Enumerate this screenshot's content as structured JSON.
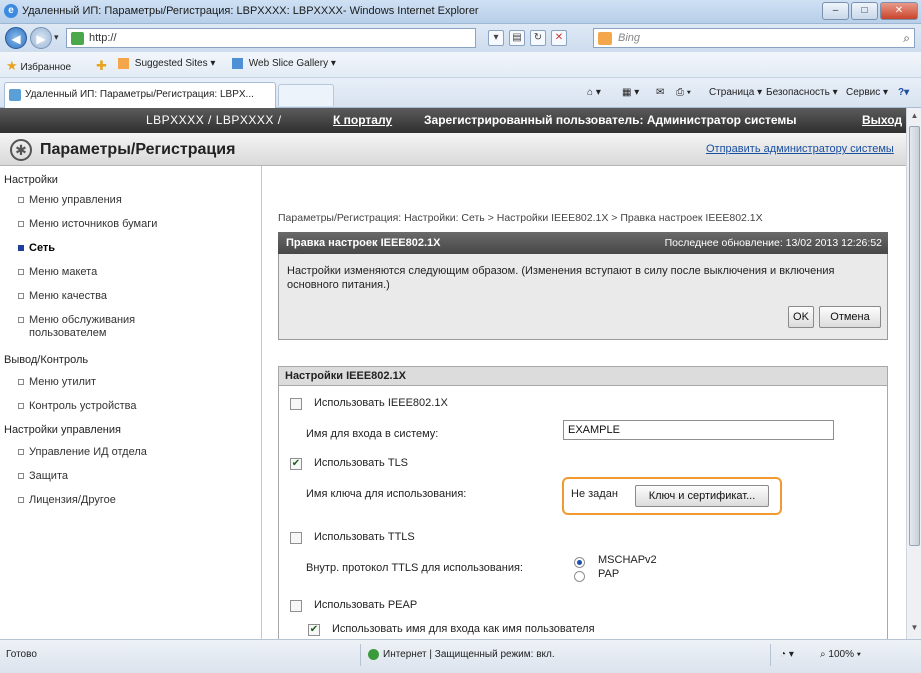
{
  "window": {
    "title": "Удаленный ИП: Параметры/Регистрация: LBPXXXX: LBPXXXX- Windows Internet Explorer",
    "min": "–",
    "max": "□",
    "close": "✕"
  },
  "addressbar": {
    "url": "http://",
    "search_placeholder": "Bing"
  },
  "favorites": {
    "favorites_label": "Избранное",
    "suggested": "Suggested Sites ▾",
    "webslice": "Web Slice Gallery ▾"
  },
  "tab": {
    "label": "Удаленный ИП: Параметры/Регистрация: LBPX..."
  },
  "commandbar": {
    "page": "Страница ▾",
    "safety": "Безопасность ▾",
    "tools": "Сервис ▾",
    "help": "?▾"
  },
  "header": {
    "model": "LBPXXXX / LBPXXXX /",
    "portal": "К порталу",
    "user": "Зарегистрированный пользователь: Администратор системы",
    "logout": "Выход"
  },
  "page": {
    "title": "Параметры/Регистрация",
    "send_admin": "Отправить администратору системы"
  },
  "sidebar": {
    "sec1": "Настройки",
    "items1": [
      "Меню управления",
      "Меню источников бумаги",
      "Сеть",
      "Меню макета",
      "Меню качества",
      "Меню обслуживания",
      "пользователем"
    ],
    "sec2": "Вывод/Контроль",
    "items2": [
      "Меню утилит",
      "Контроль устройства"
    ],
    "sec3": "Настройки управления",
    "items3": [
      "Управление ИД отдела",
      "Защита",
      "Лицензия/Другое"
    ]
  },
  "main": {
    "breadcrumb": "Параметры/Регистрация: Настройки: Сеть > Настройки IEEE802.1X > Правка настроек IEEE802.1X",
    "edit_title": "Правка настроек IEEE802.1X",
    "last_update": "Последнее обновление: 13/02 2013 12:26:52",
    "note": "Настройки изменяются следующим образом. (Изменения вступают в силу после выключения и включения основного питания.)",
    "ok": "OK",
    "cancel": "Отмена",
    "section_title": "Настройки IEEE802.1X",
    "use_ieee": "Использовать IEEE802.1X",
    "login_label": "Имя для входа в систему:",
    "login_value": "EXAMPLE",
    "use_tls": "Использовать TLS",
    "key_label": "Имя ключа для использования:",
    "key_value": "Не задан",
    "key_button": "Ключ и сертификат...",
    "use_ttls": "Использовать TTLS",
    "ttls_label": "Внутр. протокол TTLS для использования:",
    "ttls_opt1": "MSCHAPv2",
    "ttls_opt2": "PAP",
    "use_peap": "Использовать PEAP",
    "use_login_as_user": "Использовать имя для входа как имя пользователя"
  },
  "status": {
    "ready": "Готово",
    "zone": "Интернет | Защищенный режим: вкл.",
    "zoom": "100%"
  }
}
